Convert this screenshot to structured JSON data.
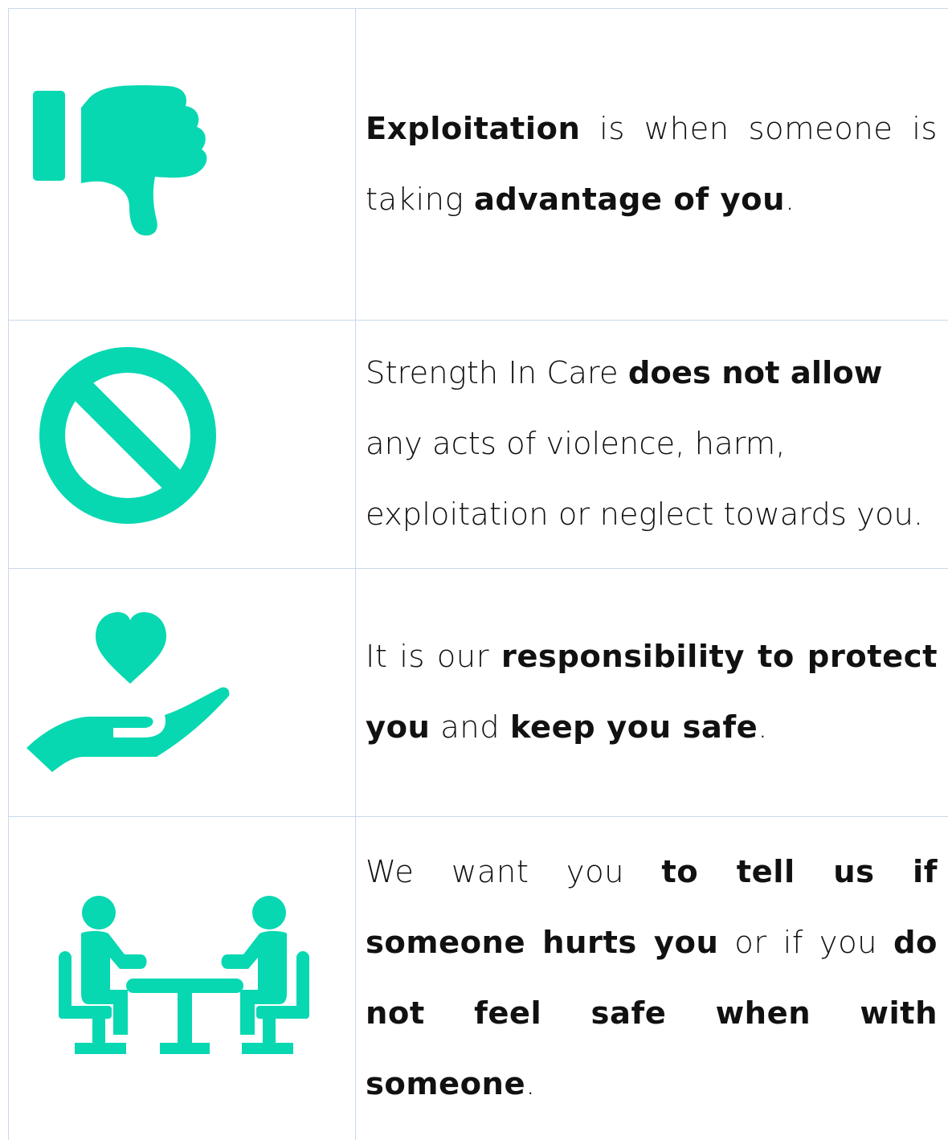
{
  "colors": {
    "icon": "#07d8b1",
    "grid_line": "#c8d8ec",
    "text": "#111111"
  },
  "rows": [
    {
      "icon": "thumbs-down-icon",
      "parts": [
        {
          "text": "Exploitation",
          "bold": true
        },
        {
          "text": " is when someone is taking ",
          "bold": false
        },
        {
          "text": "advantage of you",
          "bold": true
        },
        {
          "text": ".",
          "bold": false
        }
      ]
    },
    {
      "icon": "prohibited-icon",
      "parts": [
        {
          "text": "Strength In Care ",
          "bold": false
        },
        {
          "text": "does not allow",
          "bold": true
        },
        {
          "text": " any acts of violence, harm, exploitation or neglect towards you.",
          "bold": false
        }
      ]
    },
    {
      "icon": "heart-in-hand-icon",
      "parts": [
        {
          "text": "It is our ",
          "bold": false
        },
        {
          "text": "responsibility to protect you",
          "bold": true
        },
        {
          "text": " and ",
          "bold": false
        },
        {
          "text": "keep you safe",
          "bold": true
        },
        {
          "text": ".",
          "bold": false
        }
      ]
    },
    {
      "icon": "people-meeting-icon",
      "parts": [
        {
          "text": "We want you ",
          "bold": false
        },
        {
          "text": "to tell us if someone hurts you",
          "bold": true
        },
        {
          "text": " or if you ",
          "bold": false
        },
        {
          "text": "do not feel safe when with someone",
          "bold": true
        },
        {
          "text": ".",
          "bold": false
        }
      ]
    }
  ]
}
